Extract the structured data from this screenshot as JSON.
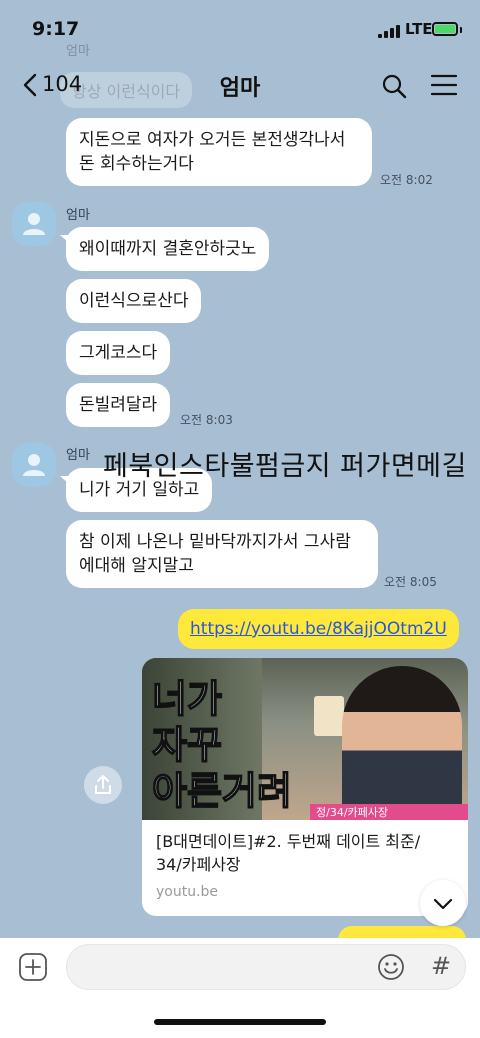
{
  "status": {
    "time": "9:17",
    "network": "LTE"
  },
  "header": {
    "back_count": "104",
    "title": "엄마"
  },
  "ghost": {
    "sender": "엄마",
    "text": "항상 이런식이다"
  },
  "messages": {
    "m1": {
      "text": "지돈으로 여자가 오거든 본전생각나서\n돈 회수하는거다",
      "time": "오전 8:02"
    },
    "g2": {
      "sender": "엄마",
      "m1": "왜이때까지 결혼안하긋노",
      "m2": "이런식으로산다",
      "m3": "그게코스다",
      "m4": "돈빌려달라",
      "time": "오전 8:03"
    },
    "g3": {
      "sender": "엄마",
      "m1": "니가 거기 일하고",
      "m2": "참 이제 나온나 밑바닥까지가서 그사람\n에대해 알지말고",
      "time": "오전 8:05"
    }
  },
  "overlay_text": "페북인스타불펌금지 퍼가면메길",
  "sent": {
    "link_text": "https://youtu.be/8KajjOOtm2U",
    "card": {
      "thumb_text": "너가\n자꾸\n아른거려",
      "thumb_bar": "정/34/카페사장",
      "title": "[B대면데이트]#2. 두번째 데이트 최준/\n34/카페사장",
      "domain": "youtu.be"
    }
  },
  "colors": {
    "background": "#a8bfd3",
    "my_bubble": "#fde83b",
    "link": "#2b57d6"
  },
  "icons": [
    "back-icon",
    "search-icon",
    "menu-icon",
    "share-icon",
    "chevron-down-icon",
    "plus-icon",
    "emoji-icon",
    "hash-icon"
  ]
}
